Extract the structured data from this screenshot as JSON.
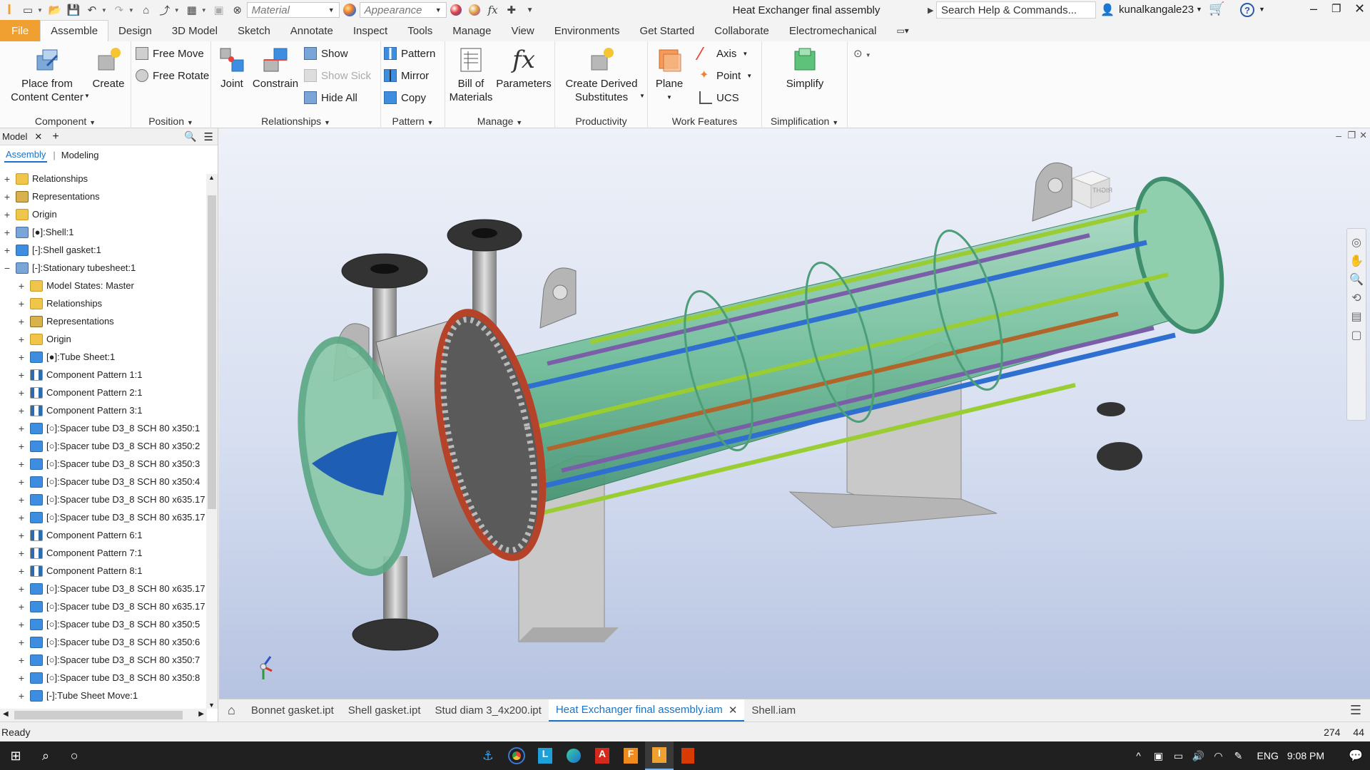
{
  "titlebar": {
    "app_letter": "I",
    "material_combo": "Material",
    "appearance_combo": "Appearance",
    "document_title": "Heat Exchanger final assembly",
    "search_placeholder": "Search Help & Commands...",
    "user_name": "kunalkangale23",
    "help_icon": "?"
  },
  "ribbon_tabs": [
    "File",
    "Assemble",
    "Design",
    "3D Model",
    "Sketch",
    "Annotate",
    "Inspect",
    "Tools",
    "Manage",
    "View",
    "Environments",
    "Get Started",
    "Collaborate",
    "Electromechanical"
  ],
  "ribbon": {
    "component": {
      "title": "Component",
      "place_label_1": "Place from",
      "place_label_2": "Content Center",
      "create_label": "Create"
    },
    "position": {
      "title": "Position",
      "free_move": "Free Move",
      "free_rotate": "Free Rotate"
    },
    "relationships": {
      "title": "Relationships",
      "joint": "Joint",
      "constrain": "Constrain",
      "show": "Show",
      "show_sick": "Show Sick",
      "hide_all": "Hide All"
    },
    "pattern": {
      "title": "Pattern",
      "pattern": "Pattern",
      "mirror": "Mirror",
      "copy": "Copy"
    },
    "manage": {
      "title": "Manage",
      "bom_1": "Bill of",
      "bom_2": "Materials",
      "parameters": "Parameters"
    },
    "productivity": {
      "title": "Productivity",
      "derived_1": "Create Derived",
      "derived_2": "Substitutes"
    },
    "work_features": {
      "title": "Work Features",
      "plane": "Plane",
      "axis": "Axis",
      "point": "Point",
      "ucs": "UCS"
    },
    "simplification": {
      "title": "Simplification",
      "simplify": "Simplify"
    }
  },
  "browser": {
    "tab_label": "Model",
    "sub_assembly": "Assembly",
    "sub_modeling": "Modeling",
    "items": [
      {
        "label": "Relationships",
        "icon": "folder",
        "expand": "+",
        "indent": 0
      },
      {
        "label": "Representations",
        "icon": "rep",
        "expand": "+",
        "indent": 0
      },
      {
        "label": "Origin",
        "icon": "folder",
        "expand": "+",
        "indent": 0
      },
      {
        "label": "[●]:Shell:1",
        "icon": "asm",
        "expand": "+",
        "indent": 0
      },
      {
        "label": "[-]:Shell gasket:1",
        "icon": "part",
        "expand": "+",
        "indent": 0
      },
      {
        "label": "[-]:Stationary tubesheet:1",
        "icon": "asm",
        "expand": "−",
        "indent": 0
      },
      {
        "label": "Model States: Master",
        "icon": "folder",
        "expand": "+",
        "indent": 1
      },
      {
        "label": "Relationships",
        "icon": "folder",
        "expand": "+",
        "indent": 1
      },
      {
        "label": "Representations",
        "icon": "rep",
        "expand": "+",
        "indent": 1
      },
      {
        "label": "Origin",
        "icon": "folder",
        "expand": "+",
        "indent": 1
      },
      {
        "label": "[●]:Tube Sheet:1",
        "icon": "part",
        "expand": "+",
        "indent": 1
      },
      {
        "label": "Component Pattern 1:1",
        "icon": "pattern",
        "expand": "+",
        "indent": 1
      },
      {
        "label": "Component Pattern 2:1",
        "icon": "pattern",
        "expand": "+",
        "indent": 1
      },
      {
        "label": "Component Pattern 3:1",
        "icon": "pattern",
        "expand": "+",
        "indent": 1
      },
      {
        "label": "[○]:Spacer tube D3_8 SCH 80 x350:1",
        "icon": "part",
        "expand": "+",
        "indent": 1
      },
      {
        "label": "[○]:Spacer tube D3_8 SCH 80 x350:2",
        "icon": "part",
        "expand": "+",
        "indent": 1
      },
      {
        "label": "[○]:Spacer tube D3_8 SCH 80 x350:3",
        "icon": "part",
        "expand": "+",
        "indent": 1
      },
      {
        "label": "[○]:Spacer tube D3_8 SCH 80 x350:4",
        "icon": "part",
        "expand": "+",
        "indent": 1
      },
      {
        "label": "[○]:Spacer tube D3_8 SCH 80 x635.17",
        "icon": "part",
        "expand": "+",
        "indent": 1
      },
      {
        "label": "[○]:Spacer tube D3_8 SCH 80 x635.17",
        "icon": "part",
        "expand": "+",
        "indent": 1
      },
      {
        "label": "Component Pattern 6:1",
        "icon": "pattern",
        "expand": "+",
        "indent": 1
      },
      {
        "label": "Component Pattern 7:1",
        "icon": "pattern",
        "expand": "+",
        "indent": 1
      },
      {
        "label": "Component Pattern 8:1",
        "icon": "pattern",
        "expand": "+",
        "indent": 1
      },
      {
        "label": "[○]:Spacer tube D3_8 SCH 80 x635.17",
        "icon": "part",
        "expand": "+",
        "indent": 1
      },
      {
        "label": "[○]:Spacer tube D3_8 SCH 80 x635.17",
        "icon": "part",
        "expand": "+",
        "indent": 1
      },
      {
        "label": "[○]:Spacer tube D3_8 SCH 80 x350:5",
        "icon": "part",
        "expand": "+",
        "indent": 1
      },
      {
        "label": "[○]:Spacer tube D3_8 SCH 80 x350:6",
        "icon": "part",
        "expand": "+",
        "indent": 1
      },
      {
        "label": "[○]:Spacer tube D3_8 SCH 80 x350:7",
        "icon": "part",
        "expand": "+",
        "indent": 1
      },
      {
        "label": "[○]:Spacer tube D3_8 SCH 80 x350:8",
        "icon": "part",
        "expand": "+",
        "indent": 1
      },
      {
        "label": "[-]:Tube Sheet Move:1",
        "icon": "part",
        "expand": "+",
        "indent": 1
      }
    ]
  },
  "doc_tabs": [
    "Bonnet gasket.ipt",
    "Shell gasket.ipt",
    "Stud diam 3_4x200.ipt",
    "Heat Exchanger final assembly.iam",
    "Shell.iam"
  ],
  "active_doc_tab": "Heat Exchanger final assembly.iam",
  "viewcube_label": "RIGHT",
  "status": {
    "text": "Ready",
    "count_a": "274",
    "count_b": "44"
  },
  "taskbar": {
    "language": "ENG",
    "time": "9:08 PM"
  },
  "colors": {
    "file_tab": "#f0a030",
    "accent": "#1a73c7",
    "taskbar": "#202020"
  }
}
